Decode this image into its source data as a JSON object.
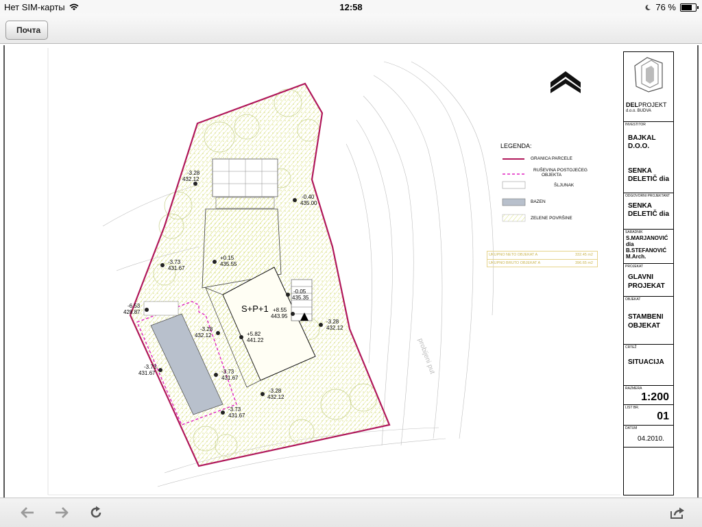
{
  "statusbar": {
    "carrier": "Нет SIM-карты",
    "time": "12:58",
    "battery": "76 %",
    "battery_level": 0.76
  },
  "nav": {
    "back_label": "Почта"
  },
  "drawing": {
    "title_block": {
      "company_bold": "DEL",
      "company_rest": "PROJEKT",
      "company_sub": "d.o.o. BUDVA",
      "investor_label": "INVESTITOR",
      "investor_line1": "BAJKAL",
      "investor_line2": "D.O.O.",
      "designer_line1": "SENKA",
      "designer_line2": "DELETIČ  dia",
      "responsible_label": "ODGOVORNI PROJEKTANT",
      "responsible_line1": "SENKA",
      "responsible_line2": "DELETIČ  dia",
      "associate_label": "SARADNIK",
      "associate_line1": "S.MARJANOVIĆ",
      "associate_line2": "dia",
      "associate_line3": "B.STEFANOVIĆ",
      "associate_line4": "M.Arch.",
      "project_label": "PROJEKAT",
      "project_line1": "GLAVNI",
      "project_line2": "PROJEKAT",
      "object_label": "OBJEKAT",
      "object_line1": "STAMBENI",
      "object_line2": "OBJEKAT",
      "sheet_label": "CRTEŽ",
      "sheet_value": "SITUACIJA",
      "scale_label": "RAZMERA",
      "scale_value": "1:200",
      "sheet_no_label": "LIST BR.",
      "sheet_no_value": "01",
      "date_label": "DATUM",
      "date_value": "04.2010."
    },
    "legend": {
      "title": "LEGENDA:",
      "items": [
        "GRANICA PARCELE",
        "RUŠEVINA POSTOJEĆEG",
        "OBJEKTA",
        "ŠLJUNAK",
        "BAZEN",
        "ZELENE POVRŠINE"
      ]
    },
    "areas": {
      "neto_label": "UKUPNO NETO OBJEKAT A",
      "neto_value": "332.45 m2",
      "bruto_label": "UKUPNO BRUTO OBJEKAT A",
      "bruto_value": "396.65 m2"
    },
    "building_label": "S+P+1",
    "road_label": "probijeni put",
    "elevations": [
      {
        "a": "-3.28",
        "b": "432.12"
      },
      {
        "a": "-0.40",
        "b": "435.00"
      },
      {
        "a": "-3.73",
        "b": "431.67"
      },
      {
        "a": "+0.15",
        "b": "435.55"
      },
      {
        "a": "-0.05",
        "b": "435.35"
      },
      {
        "a": "-6.53",
        "b": "428.87"
      },
      {
        "a": "+8.55",
        "b": "443.95"
      },
      {
        "a": "-3.28",
        "b": "432.12"
      },
      {
        "a": "-3.28",
        "b": "432.12"
      },
      {
        "a": "+5.82",
        "b": "441.22"
      },
      {
        "a": "-3.73",
        "b": "431.67"
      },
      {
        "a": "-3.73",
        "b": "431.67"
      },
      {
        "a": "-3.28",
        "b": "432.12"
      },
      {
        "a": "-3.73",
        "b": "431.67"
      }
    ]
  },
  "toolbar": {
    "back_icon": "arrow-left-icon",
    "forward_icon": "arrow-right-icon",
    "reload_icon": "reload-icon",
    "share_icon": "share-icon"
  },
  "colors": {
    "parcel_border": "#b0175a",
    "ruin_border": "#e020c0",
    "pool": "#b8c0cc",
    "green_hatch": "#d9e27a",
    "toolbar_icon": "#555555"
  }
}
